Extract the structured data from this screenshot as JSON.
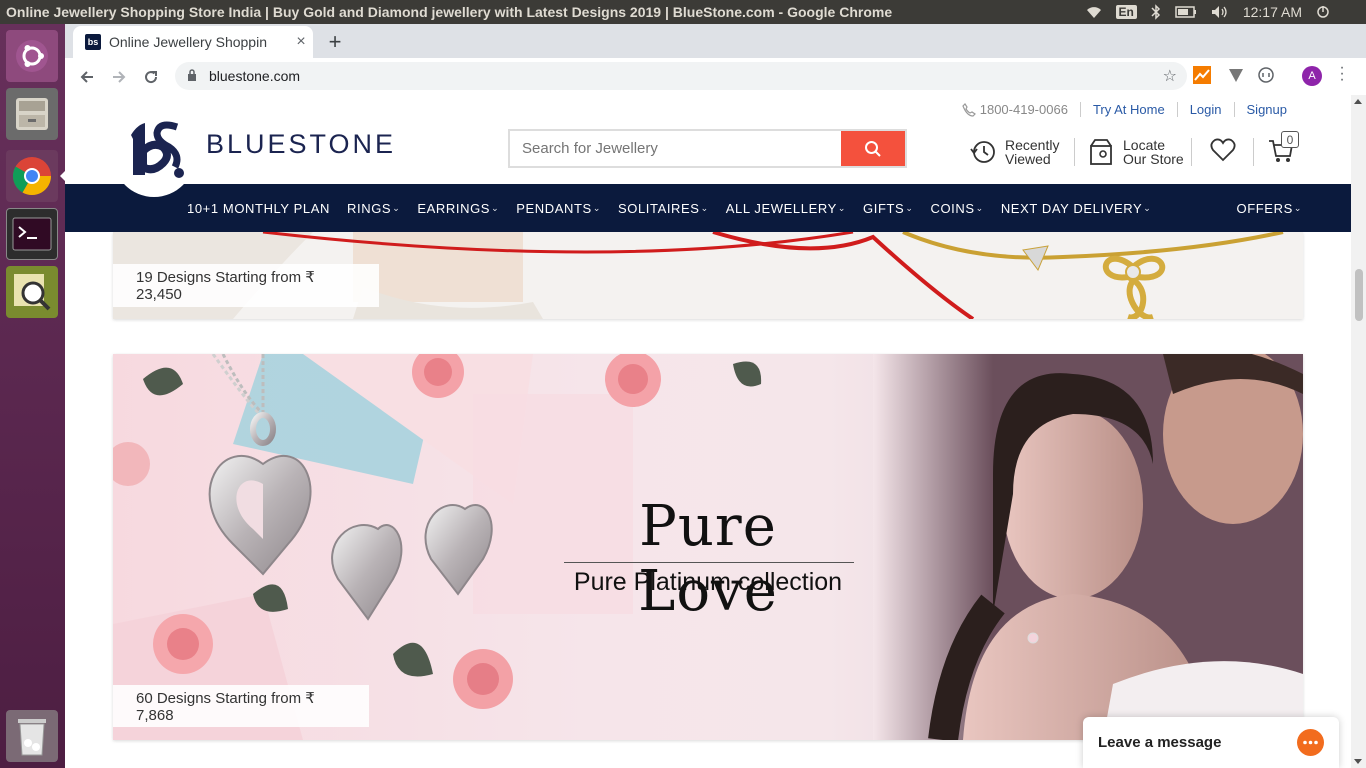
{
  "os": {
    "window_title": "Online Jewellery Shopping Store India | Buy Gold and Diamond jewellery with Latest Designs 2019 | BlueStone.com - Google Chrome",
    "lang": "En",
    "clock": "12:17 AM"
  },
  "browser": {
    "tab_title": "Online Jewellery Shoppin",
    "tab_close": "×",
    "new_tab": "+",
    "url": "bluestone.com",
    "avatar_letter": "A"
  },
  "site": {
    "phone": "1800-419-0066",
    "links": [
      "Try At Home",
      "Login",
      "Signup"
    ],
    "logo_text": "BLUESTONE",
    "search_placeholder": "Search for Jewellery",
    "recently_viewed": [
      "Recently",
      "Viewed"
    ],
    "locate_store": [
      "Locate",
      "Our Store"
    ],
    "cart_count": "0",
    "nav": [
      {
        "label": "10+1 MONTHLY PLAN",
        "chevron": false
      },
      {
        "label": "RINGS",
        "chevron": true
      },
      {
        "label": "EARRINGS",
        "chevron": true
      },
      {
        "label": "PENDANTS",
        "chevron": true
      },
      {
        "label": "SOLITAIRES",
        "chevron": true
      },
      {
        "label": "ALL JEWELLERY",
        "chevron": true
      },
      {
        "label": "GIFTS",
        "chevron": true
      },
      {
        "label": "COINS",
        "chevron": true
      },
      {
        "label": "NEXT DAY DELIVERY",
        "chevron": true
      }
    ],
    "offers": "OFFERS"
  },
  "banners": [
    {
      "caption": "19 Designs Starting from ₹ 23,450"
    },
    {
      "title": "Pure Love",
      "subtitle": "Pure Platinum collection",
      "caption": "60 Designs Starting from ₹ 7,868"
    }
  ],
  "chat": {
    "label": "Leave a message"
  },
  "colors": {
    "navy": "#0b1a3d",
    "search_button": "#f4513d",
    "link": "#2a5aa6",
    "chat_bubble": "#f26c1e"
  }
}
